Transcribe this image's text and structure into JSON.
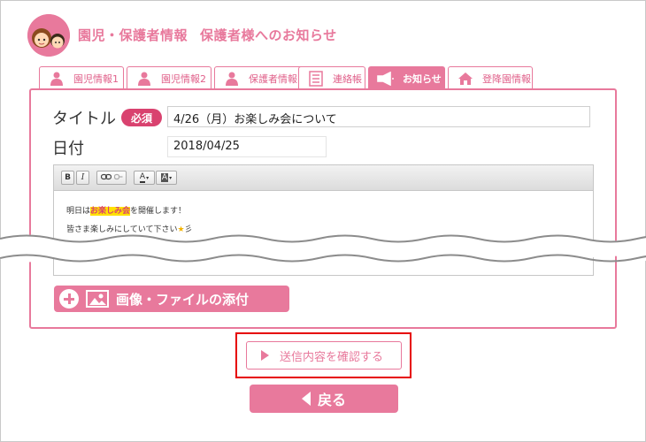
{
  "header": {
    "title": "園児・保護者情報",
    "subtitle": "保護者様へのお知らせ",
    "accent_color": "#e8799c"
  },
  "tabs": [
    {
      "label": "園児情報1",
      "icon": "person-icon",
      "active": false
    },
    {
      "label": "園児情報2",
      "icon": "person-icon",
      "active": false
    },
    {
      "label": "保護者情報",
      "icon": "person-icon",
      "active": false
    },
    {
      "label": "連絡帳",
      "icon": "notebook-icon",
      "active": false
    },
    {
      "label": "お知らせ",
      "icon": "megaphone-icon",
      "active": true
    },
    {
      "label": "登降園情報",
      "icon": "house-icon",
      "active": false
    }
  ],
  "form": {
    "title_label": "タイトル",
    "required_badge": "必須",
    "title_value": "4/26（月）お楽しみ会について",
    "date_label": "日付",
    "date_value": "2018/04/25"
  },
  "editor": {
    "toolbar": {
      "bold": "B",
      "italic": "I",
      "text_color": "A",
      "bg_color": "A"
    },
    "line1_before": "明日は",
    "line1_highlight": "お楽しみ会",
    "line1_after": "を開催します！",
    "line2": "皆さま楽しみにしていて下さい",
    "line2_star": "★",
    "line2_tail": "彡"
  },
  "attach_button": "画像・ファイルの添付",
  "confirm_button": "送信内容を確認する",
  "back_button": "戻る"
}
